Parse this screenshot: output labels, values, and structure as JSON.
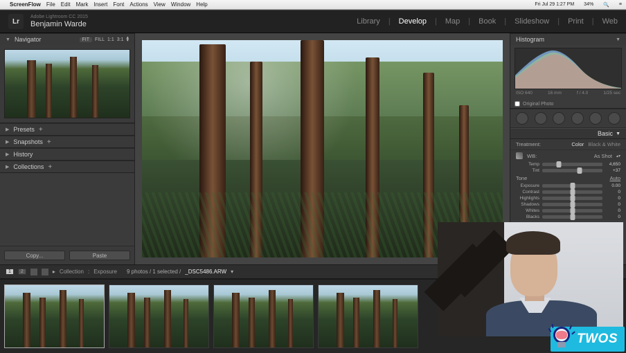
{
  "mac_menu": {
    "app": "ScreenFlow",
    "items": [
      "File",
      "Edit",
      "Mark",
      "Insert",
      "Font",
      "Actions",
      "View",
      "Window",
      "Help"
    ],
    "clock": "Fri Jul 29  1:27 PM",
    "battery_pct": "34%"
  },
  "app": {
    "title": "Adobe Lightroom CC 2015",
    "user": "Benjamin Warde"
  },
  "modules": [
    "Library",
    "Develop",
    "Map",
    "Book",
    "Slideshow",
    "Print",
    "Web"
  ],
  "active_module": "Develop",
  "left": {
    "navigator": "Navigator",
    "nav_modes": {
      "fit": "FIT",
      "fill": "FILL",
      "one": "1:1",
      "ratio": "3:1"
    },
    "presets": "Presets",
    "snapshots": "Snapshots",
    "history": "History",
    "collections": "Collections",
    "copy": "Copy...",
    "paste": "Paste"
  },
  "right": {
    "histogram": "Histogram",
    "exif": {
      "iso": "ISO 640",
      "focal": "16 mm",
      "aperture": "f / 4.0",
      "shutter": "1/25 sec"
    },
    "orig_photo": "Original Photo",
    "basic": "Basic",
    "treatment": {
      "label": "Treatment:",
      "color": "Color",
      "bw": "Black & White"
    },
    "wb": {
      "label": "WB:",
      "mode": "As Shot"
    },
    "temp": {
      "label": "Temp",
      "value": "4,650"
    },
    "tint": {
      "label": "Tint",
      "value": "+37"
    },
    "tone": {
      "label": "Tone",
      "auto": "Auto"
    },
    "sliders": {
      "exposure": {
        "label": "Exposure",
        "value": "0.00"
      },
      "contrast": {
        "label": "Contrast",
        "value": "0"
      },
      "highlights": {
        "label": "Highlights",
        "value": "0"
      },
      "shadows": {
        "label": "Shadows",
        "value": "0"
      },
      "whites": {
        "label": "Whites",
        "value": "0"
      },
      "blacks": {
        "label": "Blacks",
        "value": "0"
      }
    }
  },
  "toolbar2": {
    "pages": [
      "1",
      "2"
    ],
    "crumb_coll": "Collection",
    "crumb_name": "Exposure",
    "counts": "9 photos / 1 selected /",
    "filename": "_DSC5486.ARW"
  },
  "brand": "TWOS"
}
